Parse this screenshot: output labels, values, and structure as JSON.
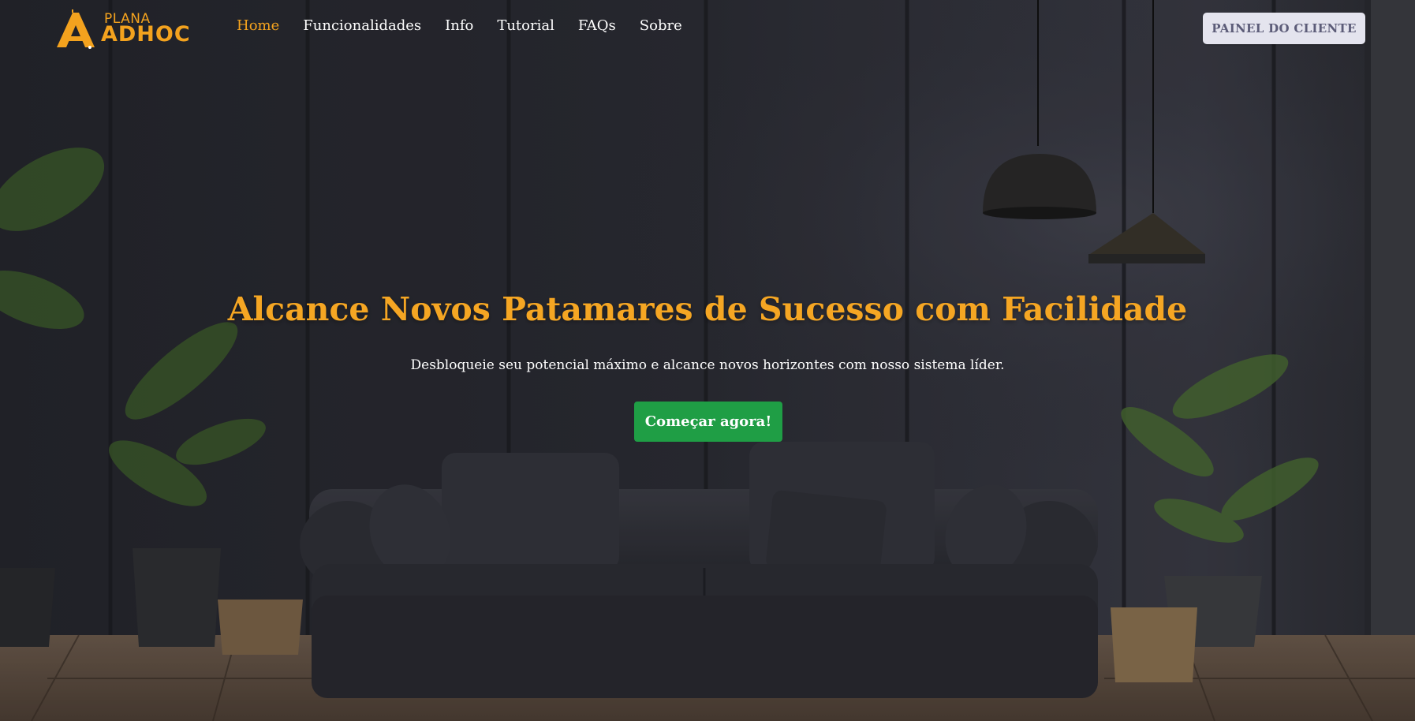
{
  "header": {
    "logo": {
      "top_text": "PLANA",
      "main_text": "ADHOC"
    },
    "nav": [
      {
        "label": "Home",
        "active": true
      },
      {
        "label": "Funcionalidades",
        "active": false
      },
      {
        "label": "Info",
        "active": false
      },
      {
        "label": "Tutorial",
        "active": false
      },
      {
        "label": "FAQs",
        "active": false
      },
      {
        "label": "Sobre",
        "active": false
      }
    ],
    "client_button": "PAINEL DO CLIENTE"
  },
  "hero": {
    "title": "Alcance Novos Patamares de Sucesso com Facilidade",
    "subtitle": "Desbloqueie seu potencial máximo e alcance novos horizontes com nosso sistema líder.",
    "cta": "Começar agora!"
  },
  "colors": {
    "accent": "#f5a623",
    "cta": "#1f9e45",
    "background": "#2a2b33"
  }
}
